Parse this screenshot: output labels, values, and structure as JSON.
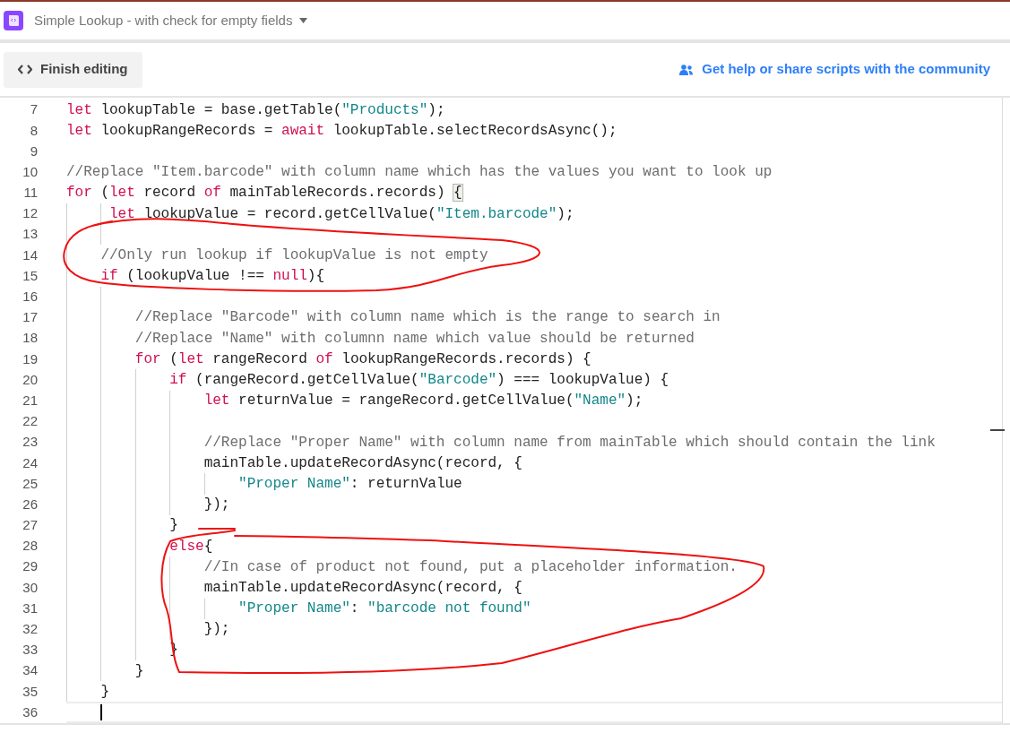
{
  "header": {
    "title": "Simple Lookup - with check for empty fields"
  },
  "toolbar": {
    "finish_button": "Finish editing",
    "community_link": "Get help or share scripts with the community"
  },
  "editor": {
    "lines": [
      {
        "number": "7",
        "current": false,
        "tokens": [
          {
            "kind": "kw",
            "text": "let"
          },
          {
            "kind": "txt",
            "text": " lookupTable = base.getTable("
          },
          {
            "kind": "str",
            "text": "\"Products\""
          },
          {
            "kind": "txt",
            "text": ");"
          }
        ]
      },
      {
        "number": "8",
        "current": false,
        "tokens": [
          {
            "kind": "kw",
            "text": "let"
          },
          {
            "kind": "txt",
            "text": " lookupRangeRecords = "
          },
          {
            "kind": "kw",
            "text": "await"
          },
          {
            "kind": "txt",
            "text": " lookupTable.selectRecordsAsync();"
          }
        ]
      },
      {
        "number": "9",
        "current": false
      },
      {
        "number": "10",
        "current": false,
        "tokens": [
          {
            "kind": "com",
            "text": "//Replace \"Item.barcode\" with column name which has the values you want to look up"
          }
        ]
      },
      {
        "number": "11",
        "current": false,
        "tokens": [
          {
            "kind": "kw",
            "text": "for"
          },
          {
            "kind": "txt",
            "text": " ("
          },
          {
            "kind": "kw",
            "text": "let"
          },
          {
            "kind": "txt",
            "text": " record "
          },
          {
            "kind": "kw",
            "text": "of"
          },
          {
            "kind": "txt",
            "text": " mainTableRecords.records) "
          },
          {
            "kind": "match",
            "text": "{"
          }
        ]
      },
      {
        "number": "12",
        "current": false,
        "tokens": [
          {
            "kind": "kw",
            "text": "     let"
          },
          {
            "kind": "txt",
            "text": " lookupValue = record.getCellValue("
          },
          {
            "kind": "str",
            "text": "\"Item.barcode\""
          },
          {
            "kind": "txt",
            "text": ");"
          }
        ]
      },
      {
        "number": "13",
        "current": false
      },
      {
        "number": "14",
        "current": false,
        "tokens": [
          {
            "kind": "com",
            "text": "    //Only run lookup if lookupValue is not empty"
          }
        ]
      },
      {
        "number": "15",
        "current": false,
        "tokens": [
          {
            "kind": "kw",
            "text": "    if"
          },
          {
            "kind": "txt",
            "text": " (lookupValue !== "
          },
          {
            "kind": "kw",
            "text": "null"
          },
          {
            "kind": "txt",
            "text": "){"
          }
        ]
      },
      {
        "number": "16",
        "current": false
      },
      {
        "number": "17",
        "current": false,
        "tokens": [
          {
            "kind": "com",
            "text": "        //Replace \"Barcode\" with column name which is the range to search in"
          }
        ]
      },
      {
        "number": "18",
        "current": false,
        "tokens": [
          {
            "kind": "com",
            "text": "        //Replace \"Name\" with columnn name which value should be returned"
          }
        ]
      },
      {
        "number": "19",
        "current": false,
        "tokens": [
          {
            "kind": "kw",
            "text": "        for"
          },
          {
            "kind": "txt",
            "text": " ("
          },
          {
            "kind": "kw",
            "text": "let"
          },
          {
            "kind": "txt",
            "text": " rangeRecord "
          },
          {
            "kind": "kw",
            "text": "of"
          },
          {
            "kind": "txt",
            "text": " lookupRangeRecords.records) {"
          }
        ]
      },
      {
        "number": "20",
        "current": false,
        "tokens": [
          {
            "kind": "kw",
            "text": "            if"
          },
          {
            "kind": "txt",
            "text": " (rangeRecord.getCellValue("
          },
          {
            "kind": "str",
            "text": "\"Barcode\""
          },
          {
            "kind": "txt",
            "text": ") === lookupValue) {"
          }
        ]
      },
      {
        "number": "21",
        "current": false,
        "tokens": [
          {
            "kind": "kw",
            "text": "                let"
          },
          {
            "kind": "txt",
            "text": " returnValue = rangeRecord.getCellValue("
          },
          {
            "kind": "str",
            "text": "\"Name\""
          },
          {
            "kind": "txt",
            "text": ");"
          }
        ]
      },
      {
        "number": "22",
        "current": false
      },
      {
        "number": "23",
        "current": false,
        "tokens": [
          {
            "kind": "com",
            "text": "                //Replace \"Proper Name\" with column name from mainTable which should contain the link"
          }
        ]
      },
      {
        "number": "24",
        "current": false,
        "tokens": [
          {
            "kind": "txt",
            "text": "                mainTable.updateRecordAsync(record, {"
          }
        ]
      },
      {
        "number": "25",
        "current": false,
        "tokens": [
          {
            "kind": "str",
            "text": "                    \"Proper Name\""
          },
          {
            "kind": "txt",
            "text": ": returnValue"
          }
        ]
      },
      {
        "number": "26",
        "current": false,
        "tokens": [
          {
            "kind": "txt",
            "text": "                });"
          }
        ]
      },
      {
        "number": "27",
        "current": false,
        "tokens": [
          {
            "kind": "txt",
            "text": "            }"
          }
        ]
      },
      {
        "number": "28",
        "current": false,
        "tokens": [
          {
            "kind": "kw",
            "text": "            else"
          },
          {
            "kind": "txt",
            "text": "{"
          }
        ]
      },
      {
        "number": "29",
        "current": false,
        "tokens": [
          {
            "kind": "com",
            "text": "                //In case of product not found, put a placeholder information."
          }
        ]
      },
      {
        "number": "30",
        "current": false,
        "tokens": [
          {
            "kind": "txt",
            "text": "                mainTable.updateRecordAsync(record, {"
          }
        ]
      },
      {
        "number": "31",
        "current": false,
        "tokens": [
          {
            "kind": "str",
            "text": "                    \"Proper Name\""
          },
          {
            "kind": "txt",
            "text": ": "
          },
          {
            "kind": "str",
            "text": "\"barcode not found\""
          }
        ]
      },
      {
        "number": "32",
        "current": false,
        "tokens": [
          {
            "kind": "txt",
            "text": "                });"
          }
        ]
      },
      {
        "number": "33",
        "current": false,
        "tokens": [
          {
            "kind": "txt",
            "text": "            }"
          }
        ]
      },
      {
        "number": "34",
        "current": false,
        "tokens": [
          {
            "kind": "txt",
            "text": "        }"
          }
        ]
      },
      {
        "number": "35",
        "current": false,
        "tokens": [
          {
            "kind": "txt",
            "text": "    }"
          }
        ]
      },
      {
        "number": "36",
        "current": true
      }
    ]
  },
  "annotations": [
    {
      "kind": "loop"
    },
    {
      "kind": "loop"
    }
  ]
}
